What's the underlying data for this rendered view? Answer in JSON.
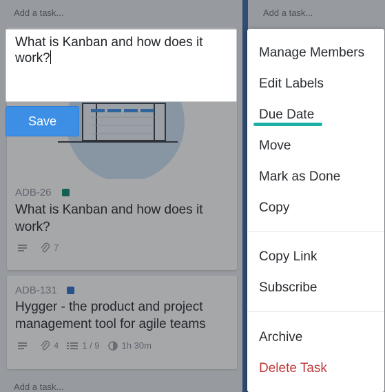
{
  "board": {
    "left_column": {
      "add_task_top": "Add a task...",
      "add_task_bottom": "Add a task..."
    },
    "right_column": {
      "add_task_top": "Add a task..."
    }
  },
  "editor": {
    "text": "What is Kanban and how does it work?",
    "save_label": "Save"
  },
  "cards": [
    {
      "code": "ADB-26",
      "label_color": "#0b8a6b",
      "title": "What is Kanban and how does it work?",
      "attachments": "7"
    },
    {
      "code": "ADB-131",
      "label_color": "#2e72d2",
      "title": "Hygger - the product and project management tool for agile teams",
      "attachments": "4",
      "checklist": "1 / 9",
      "time": "1h 30m"
    }
  ],
  "menu": {
    "group1": [
      "Manage Members",
      "Edit Labels",
      "Due Date",
      "Move",
      "Mark as Done",
      "Copy"
    ],
    "group2": [
      "Copy Link",
      "Subscribe"
    ],
    "group3": [
      "Archive",
      "Delete Task"
    ],
    "highlighted": "Due Date",
    "highlight_color": "#1ab0a6",
    "danger_color": "#c0393b"
  },
  "colors": {
    "accent": "#3d8fe6",
    "column_divider": "#3d6aa6"
  }
}
